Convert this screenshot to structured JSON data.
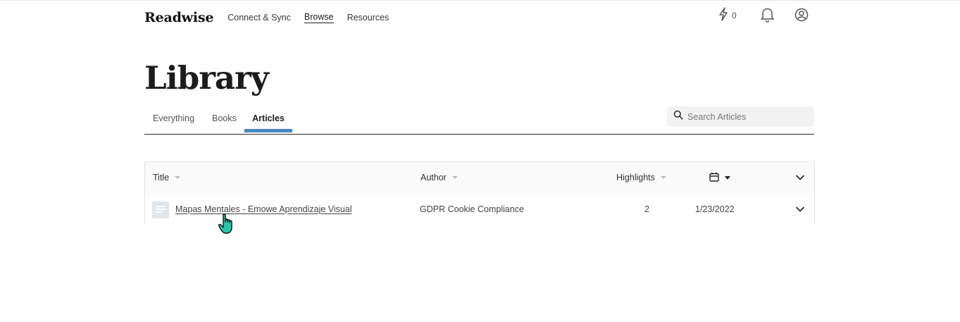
{
  "header": {
    "brand": "Readwise",
    "nav_links": [
      "Connect & Sync",
      "Browse",
      "Resources"
    ],
    "active_nav": "Browse",
    "review_count": "0",
    "icons": [
      "bolt-icon",
      "bell-icon",
      "user-icon"
    ]
  },
  "page": {
    "title": "Library"
  },
  "tabs": {
    "items": [
      "Everything",
      "Books",
      "Articles"
    ],
    "active": "Articles"
  },
  "search": {
    "placeholder": "Search Articles",
    "value": ""
  },
  "table": {
    "columns": {
      "title": "Title",
      "author": "Author",
      "highlights": "Highlights",
      "date_icon": "calendar-icon"
    },
    "rows": [
      {
        "title": "Mapas Mentales - Emowe Aprendizaje Visual",
        "author": "GDPR Cookie Compliance",
        "highlights": "2",
        "date": "1/23/2022"
      }
    ]
  },
  "colors": {
    "tab_indicator": "#4a86c4",
    "cursor_fill": "#27c6a5"
  }
}
